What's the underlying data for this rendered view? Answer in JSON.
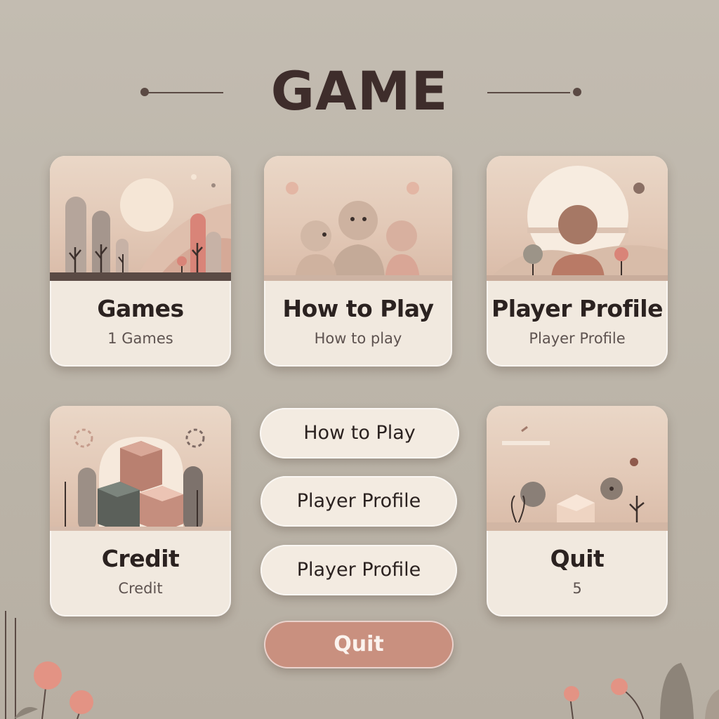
{
  "title": "GAME",
  "cards": [
    {
      "label": "Games",
      "sub": "1 Games"
    },
    {
      "label": "How to Play",
      "sub": "How to play"
    },
    {
      "label": "Player Profile",
      "sub": "Player Profile"
    },
    {
      "label": "Credit",
      "sub": "Credit"
    },
    {
      "label": "Quit",
      "sub": "5"
    }
  ],
  "buttons": [
    {
      "label": "How to Play"
    },
    {
      "label": "Player Profile"
    },
    {
      "label": "Player Profile"
    }
  ],
  "quit_button": {
    "label": "Quit"
  },
  "colors": {
    "background": "#c0b9ad",
    "card": "#f1e9df",
    "accent": "#c9907f",
    "title": "#3e2d2b"
  }
}
